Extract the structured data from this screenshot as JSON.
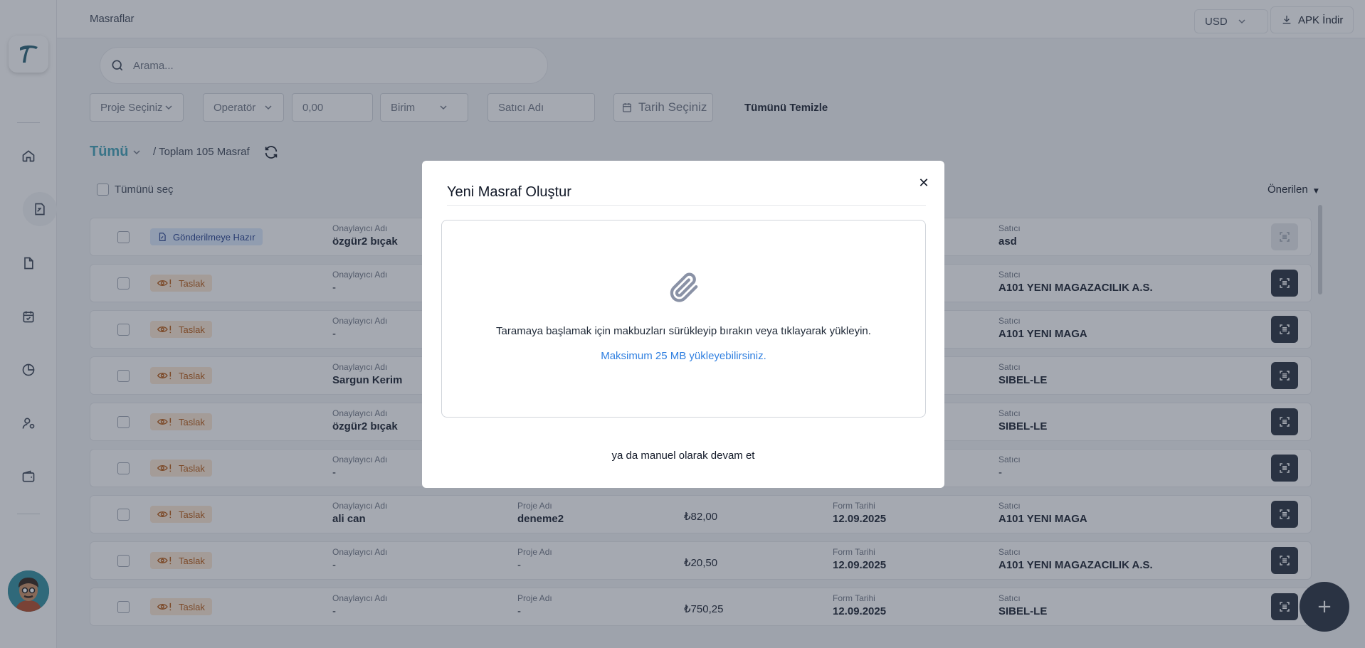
{
  "header": {
    "breadcrumb": "Masraflar",
    "currency": "USD",
    "apk_label": "APK İndir"
  },
  "search": {
    "placeholder": "Arama..."
  },
  "filters": {
    "project": "Proje Seçiniz",
    "operator": "Operatör",
    "amount": "0,00",
    "unit": "Birim",
    "vendor": "Satıcı Adı",
    "date": "Tarih Seçiniz",
    "clear_all": "Tümünü Temizle"
  },
  "list": {
    "scope": "Tümü",
    "total": "/ Toplam 105 Masraf",
    "select_all": "Tümünü seç",
    "sort": "Önerilen"
  },
  "columns": {
    "approver": "Onaylayıcı Adı",
    "project": "Proje Adı",
    "form_date": "Form Tarihi",
    "vendor": "Satıcı"
  },
  "rows": [
    {
      "status": "Gönderilmeye Hazır",
      "approver": "özgür2 bıçak",
      "project": "",
      "amount": "",
      "date": "",
      "vendor": "asd"
    },
    {
      "status": "Taslak",
      "approver": "-",
      "project": "",
      "amount": "",
      "date": "",
      "vendor": "A101 YENI MAGAZACILIK A.S."
    },
    {
      "status": "Taslak",
      "approver": "-",
      "project": "",
      "amount": "",
      "date": "",
      "vendor": "A101 YENI MAGA"
    },
    {
      "status": "Taslak",
      "approver": "Sargun Kerim",
      "project": "",
      "amount": "",
      "date": "",
      "vendor": "SIBEL-LE"
    },
    {
      "status": "Taslak",
      "approver": "özgür2 bıçak",
      "project": "",
      "amount": "",
      "date": "",
      "vendor": "SIBEL-LE"
    },
    {
      "status": "Taslak",
      "approver": "-",
      "project": "",
      "amount": "",
      "date": "",
      "vendor": "-"
    },
    {
      "status": "Taslak",
      "approver": "ali can",
      "project": "deneme2",
      "amount": "₺82,00",
      "date": "12.09.2025",
      "vendor": "A101 YENI MAGA"
    },
    {
      "status": "Taslak",
      "approver": "-",
      "project": "-",
      "amount": "₺20,50",
      "date": "12.09.2025",
      "vendor": "A101 YENI MAGAZACILIK A.S."
    },
    {
      "status": "Taslak",
      "approver": "-",
      "project": "-",
      "amount": "₺750,25",
      "date": "12.09.2025",
      "vendor": "SIBEL-LE"
    }
  ],
  "modal": {
    "title": "Yeni Masraf Oluştur",
    "drop_text": "Taramaya başlamak için makbuzları sürükleyip bırakın veya tıklayarak yükleyin.",
    "max_size": "Maksimum 25 MB yükleyebilirsiniz.",
    "manual": "ya da manuel olarak devam et"
  },
  "icons": {
    "logo": "brand-logo-icon",
    "nav": [
      "home-icon",
      "expense-icon",
      "document-icon",
      "calendar-check-icon",
      "pie-chart-icon",
      "user-settings-icon",
      "wallet-icon"
    ]
  },
  "colors": {
    "accent": "#3b9fb4",
    "dark_button": "#1f2937",
    "draft_badge": "#fde7d2",
    "ready_badge": "#dbeafe",
    "link_blue": "#2f7fe0"
  }
}
